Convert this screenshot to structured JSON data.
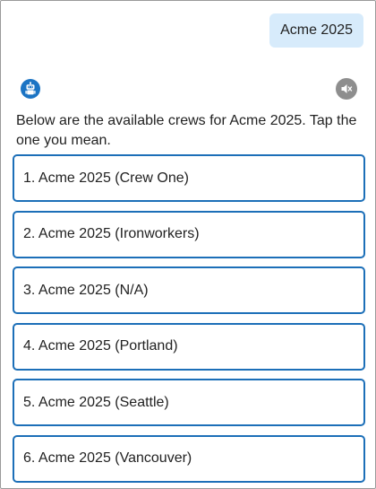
{
  "chat": {
    "user_message": "Acme 2025",
    "bot_message": "Below are the available crews for Acme 2025. Tap the one you mean.",
    "icons": {
      "bot_avatar": "robot-icon",
      "mute": "speaker-muted-icon"
    },
    "options": [
      {
        "label": "1. Acme 2025 (Crew One)"
      },
      {
        "label": "2. Acme 2025 (Ironworkers)"
      },
      {
        "label": "3. Acme 2025 (N/A)"
      },
      {
        "label": "4. Acme 2025 (Portland)"
      },
      {
        "label": "5. Acme 2025 (Seattle)"
      },
      {
        "label": "6. Acme 2025 (Vancouver)"
      }
    ]
  },
  "colors": {
    "accent": "#1c6fb8",
    "user_bubble": "#d7ebfb",
    "mute_button": "#8e8e8e",
    "text": "#222222"
  }
}
